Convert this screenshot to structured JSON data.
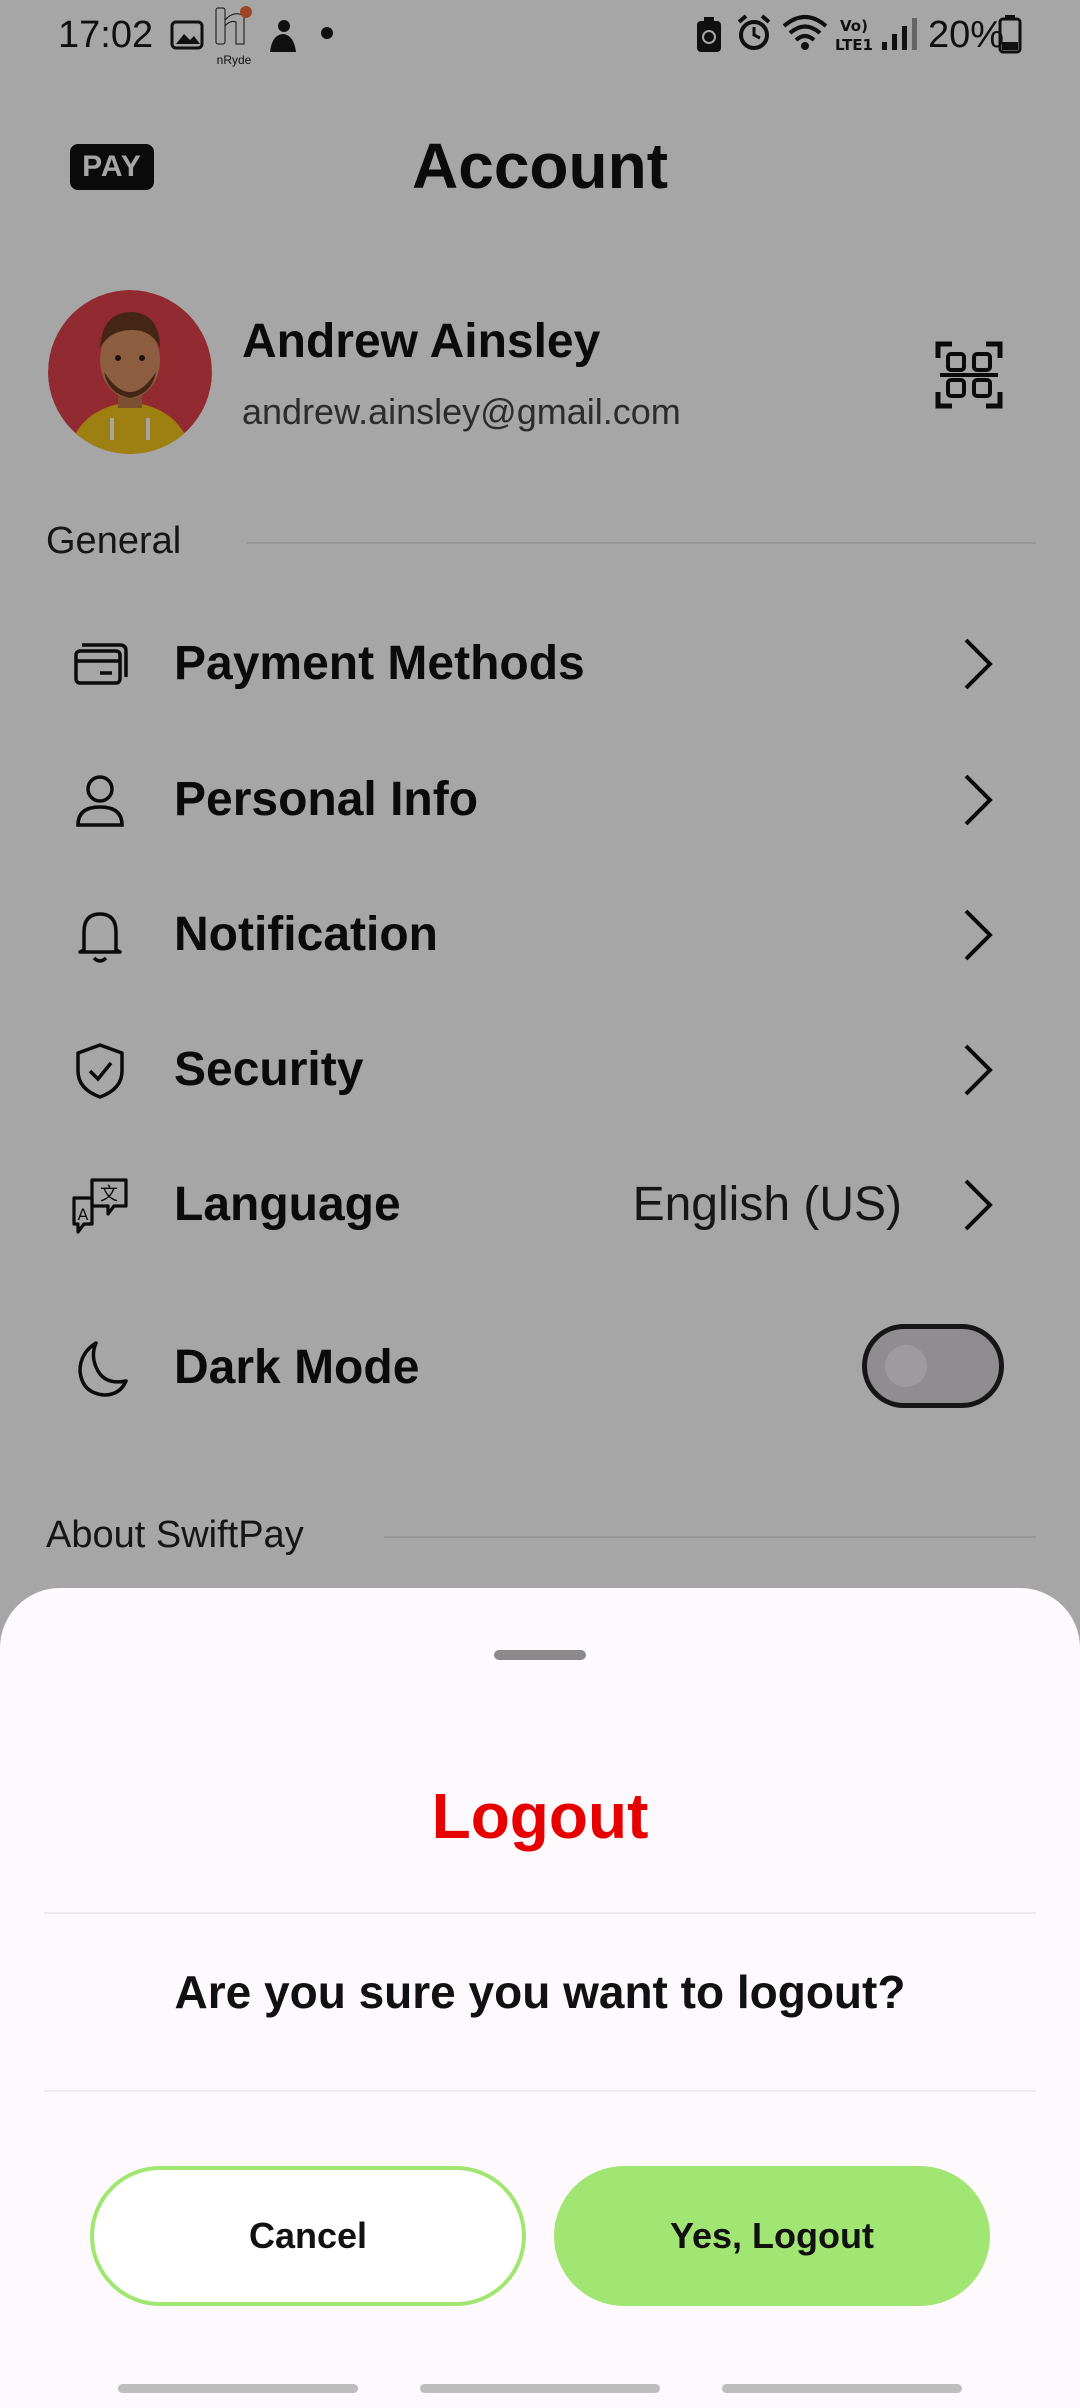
{
  "status_bar": {
    "time": "17:02",
    "app_label": "nRyde",
    "battery": "20%"
  },
  "header": {
    "badge": "PAY",
    "title": "Account"
  },
  "profile": {
    "name": "Andrew Ainsley",
    "email": "andrew.ainsley@gmail.com"
  },
  "sections": {
    "general": "General",
    "about": "About SwiftPay"
  },
  "menu": {
    "payment_methods": "Payment Methods",
    "personal_info": "Personal Info",
    "notification": "Notification",
    "security": "Security",
    "language": "Language",
    "language_value": "English (US)",
    "dark_mode": "Dark Mode",
    "dark_mode_on": false
  },
  "logout_sheet": {
    "title": "Logout",
    "message": "Are you sure you want to logout?",
    "cancel": "Cancel",
    "confirm": "Yes, Logout"
  },
  "colors": {
    "accent_green": "#a1e672",
    "danger_red": "#e60000",
    "scrim": "rgba(0,0,0,0.35)"
  }
}
